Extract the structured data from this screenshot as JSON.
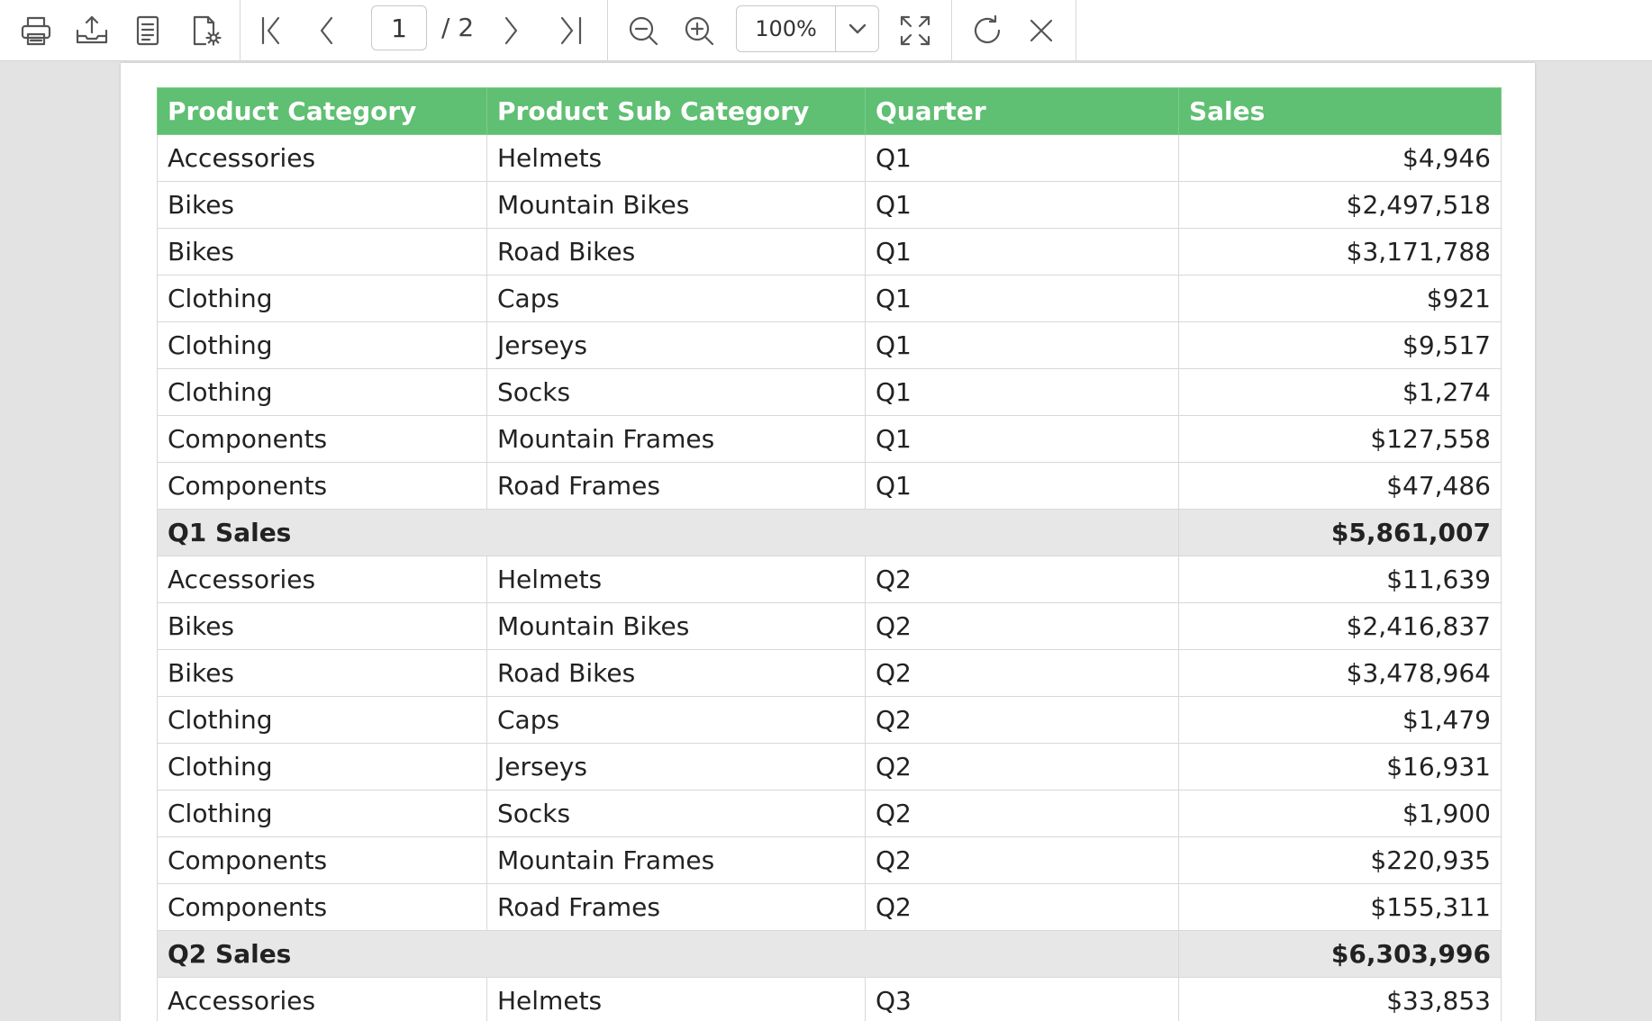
{
  "toolbar": {
    "items": [
      "print-icon",
      "export-icon",
      "document-icon",
      "page-setup-icon",
      "first-page-icon",
      "previous-page-icon",
      "next-page-icon",
      "last-page-icon",
      "zoom-out-icon",
      "zoom-in-icon",
      "fit-page-icon",
      "refresh-icon",
      "close-icon"
    ],
    "current_page": "1",
    "total_pages": "/ 2",
    "zoom": "100%"
  },
  "table": {
    "headers": [
      "Product Category",
      "Product Sub Category",
      "Quarter",
      "Sales"
    ],
    "rows": [
      {
        "category": "Accessories",
        "sub_category": "Helmets",
        "quarter": "Q1",
        "sales": "$4,946"
      },
      {
        "category": "Bikes",
        "sub_category": "Mountain Bikes",
        "quarter": "Q1",
        "sales": "$2,497,518"
      },
      {
        "category": "Bikes",
        "sub_category": "Road Bikes",
        "quarter": "Q1",
        "sales": "$3,171,788"
      },
      {
        "category": "Clothing",
        "sub_category": "Caps",
        "quarter": "Q1",
        "sales": "$921"
      },
      {
        "category": "Clothing",
        "sub_category": "Jerseys",
        "quarter": "Q1",
        "sales": "$9,517"
      },
      {
        "category": "Clothing",
        "sub_category": "Socks",
        "quarter": "Q1",
        "sales": "$1,274"
      },
      {
        "category": "Components",
        "sub_category": "Mountain Frames",
        "quarter": "Q1",
        "sales": "$127,558"
      },
      {
        "category": "Components",
        "sub_category": "Road Frames",
        "quarter": "Q1",
        "sales": "$47,486"
      },
      {
        "subtotal": true,
        "label": "Q1 Sales",
        "sales": "$5,861,007"
      },
      {
        "category": "Accessories",
        "sub_category": "Helmets",
        "quarter": "Q2",
        "sales": "$11,639"
      },
      {
        "category": "Bikes",
        "sub_category": "Mountain Bikes",
        "quarter": "Q2",
        "sales": "$2,416,837"
      },
      {
        "category": "Bikes",
        "sub_category": "Road Bikes",
        "quarter": "Q2",
        "sales": "$3,478,964"
      },
      {
        "category": "Clothing",
        "sub_category": "Caps",
        "quarter": "Q2",
        "sales": "$1,479"
      },
      {
        "category": "Clothing",
        "sub_category": "Jerseys",
        "quarter": "Q2",
        "sales": "$16,931"
      },
      {
        "category": "Clothing",
        "sub_category": "Socks",
        "quarter": "Q2",
        "sales": "$1,900"
      },
      {
        "category": "Components",
        "sub_category": "Mountain Frames",
        "quarter": "Q2",
        "sales": "$220,935"
      },
      {
        "category": "Components",
        "sub_category": "Road Frames",
        "quarter": "Q2",
        "sales": "$155,311"
      },
      {
        "subtotal": true,
        "label": "Q2 Sales",
        "sales": "$6,303,996"
      },
      {
        "category": "Accessories",
        "sub_category": "Helmets",
        "quarter": "Q3",
        "sales": "$33,853"
      }
    ]
  },
  "colors": {
    "header_bg": "#5fbf72",
    "subtotal_bg": "#e7e7e7",
    "viewer_bg": "#e3e3e3"
  }
}
